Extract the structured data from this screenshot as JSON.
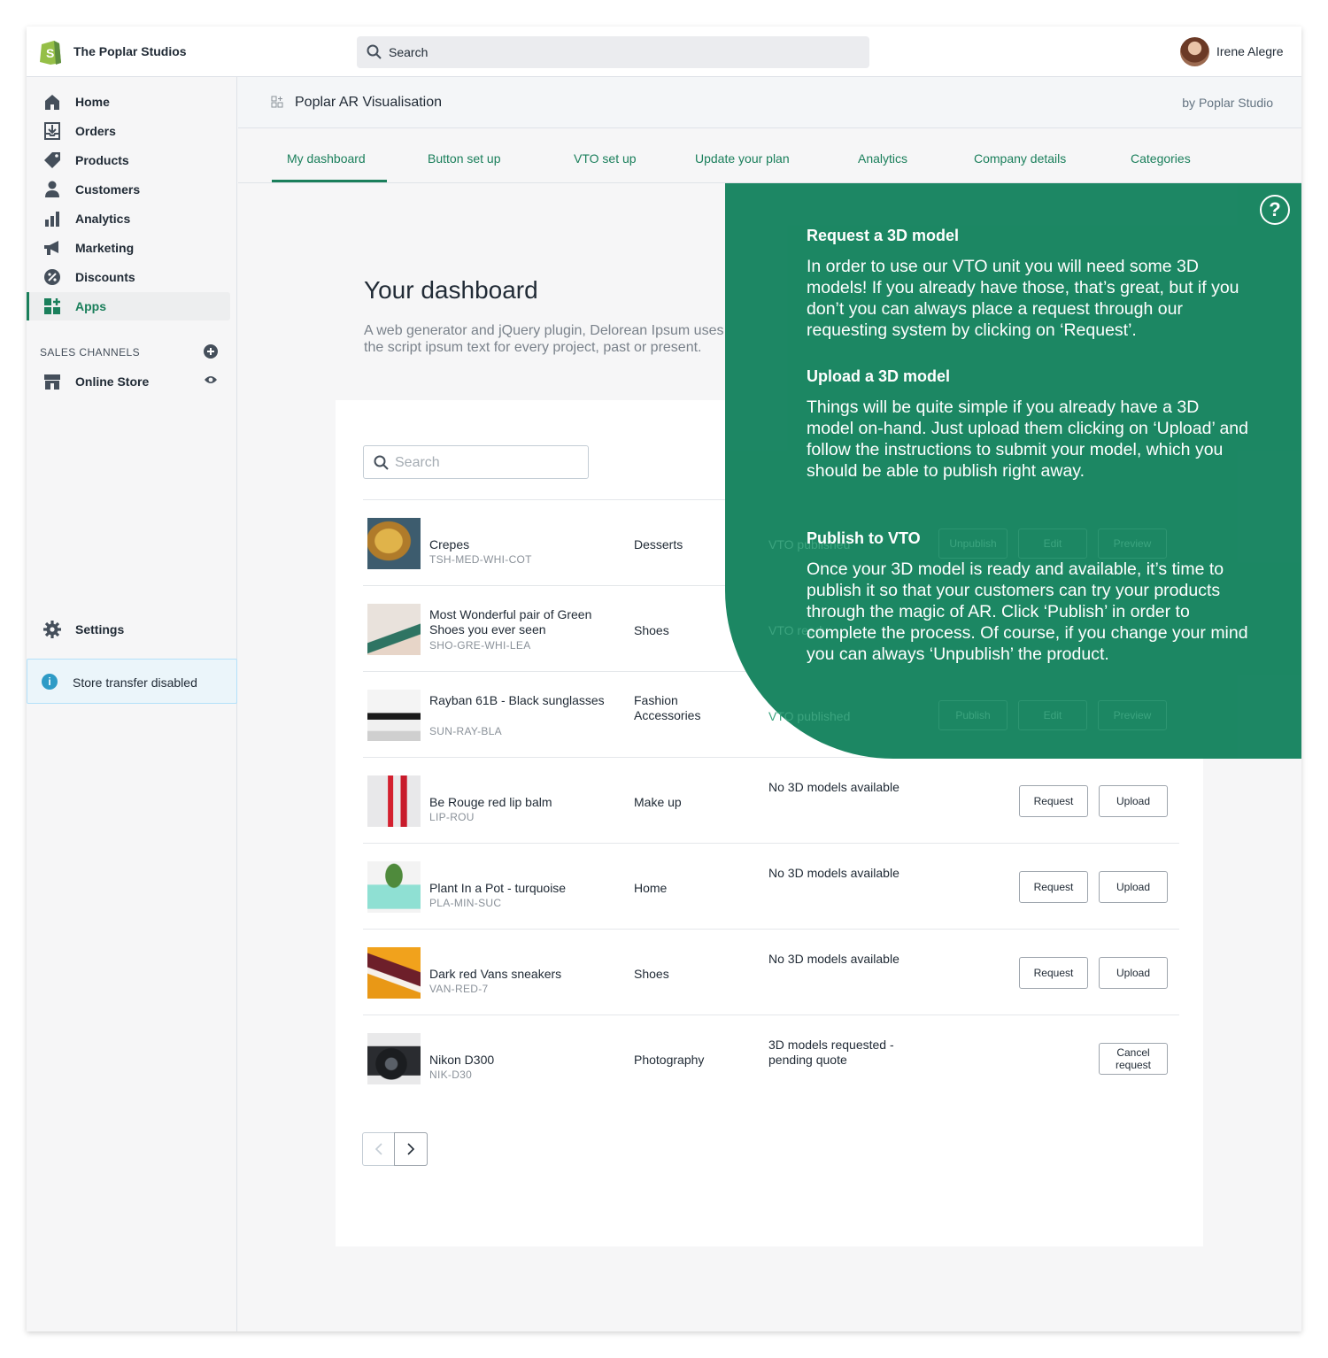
{
  "topbar": {
    "store_name": "The Poplar Studios",
    "search_placeholder": "Search",
    "user_name": "Irene Alegre"
  },
  "sidebar": {
    "items": [
      {
        "label": "Home",
        "icon": "home-icon"
      },
      {
        "label": "Orders",
        "icon": "orders-icon"
      },
      {
        "label": "Products",
        "icon": "tag-icon"
      },
      {
        "label": "Customers",
        "icon": "person-icon"
      },
      {
        "label": "Analytics",
        "icon": "bar-chart-icon"
      },
      {
        "label": "Marketing",
        "icon": "megaphone-icon"
      },
      {
        "label": "Discounts",
        "icon": "discount-icon"
      },
      {
        "label": "Apps",
        "icon": "apps-icon"
      }
    ],
    "sales_channels_heading": "SALES CHANNELS",
    "online_store": "Online Store",
    "settings": "Settings",
    "store_transfer": "Store transfer disabled",
    "accent_color": "#1a7f5b"
  },
  "app": {
    "title": "Poplar AR Visualisation",
    "by": "by Poplar Studio",
    "tabs": [
      "My dashboard",
      "Button set up",
      "VTO set up",
      "Update your plan",
      "Analytics",
      "Company details",
      "Categories"
    ],
    "active_tab": "My dashboard"
  },
  "dashboard": {
    "title": "Your dashboard",
    "subtitle": "A web generator and jQuery plugin, Delorean Ipsum uses the script ipsum text for every project, past or present.",
    "search_placeholder": "Search",
    "products": [
      {
        "name": "Crepes",
        "sku": "TSH-MED-WHI-COT",
        "category": "Desserts",
        "status": "VTO published",
        "buttons": [
          "Unpublish",
          "Edit",
          "Preview"
        ]
      },
      {
        "name": "Most Wonderful pair of Green Shoes you ever seen",
        "sku": "SHO-GRE-WHI-LEA",
        "category": "Shoes",
        "status": "VTO ready",
        "buttons": []
      },
      {
        "name": "Rayban 61B - Black sunglasses",
        "sku": "SUN-RAY-BLA",
        "category": "Fashion Accessories",
        "status": "VTO published",
        "buttons": [
          "Publish",
          "Edit",
          "Preview"
        ]
      },
      {
        "name": "Be Rouge red lip balm",
        "sku": "LIP-ROU",
        "category": "Make up",
        "status": "No 3D models available",
        "buttons": [
          "Request",
          "Upload"
        ]
      },
      {
        "name": "Plant In a Pot - turquoise",
        "sku": "PLA-MIN-SUC",
        "category": "Home",
        "status": "No 3D models available",
        "buttons": [
          "Request",
          "Upload"
        ]
      },
      {
        "name": "Dark red Vans sneakers",
        "sku": "VAN-RED-7",
        "category": "Shoes",
        "status": "No 3D models available",
        "buttons": [
          "Request",
          "Upload"
        ]
      },
      {
        "name": "Nikon D300",
        "sku": "NIK-D30",
        "category": "Photography",
        "status": "3D models requested - pending quote",
        "buttons": [
          "Cancel request"
        ]
      }
    ]
  },
  "help_overlay": {
    "color": "#1a8662",
    "sections": [
      {
        "heading": "Request a 3D model",
        "body": "In order to use our VTO unit you will need some 3D models! If you already have those, that’s great, but if you don’t you can always place a request through our requesting system by clicking on ‘Request’."
      },
      {
        "heading": "Upload a 3D model",
        "body": "Things will be quite simple if you already have a 3D model on-hand. Just upload them clicking on ‘Upload’ and follow the instructions to submit your model, which you should be able to publish right away."
      },
      {
        "heading": "Publish to VTO",
        "body": "Once your 3D model is ready and available, it’s time to publish it so that your customers can try your products through the magic of AR. Click ‘Publish’ in order to complete the process. Of course, if you change your mind you can always ‘Unpublish’ the product."
      }
    ]
  }
}
